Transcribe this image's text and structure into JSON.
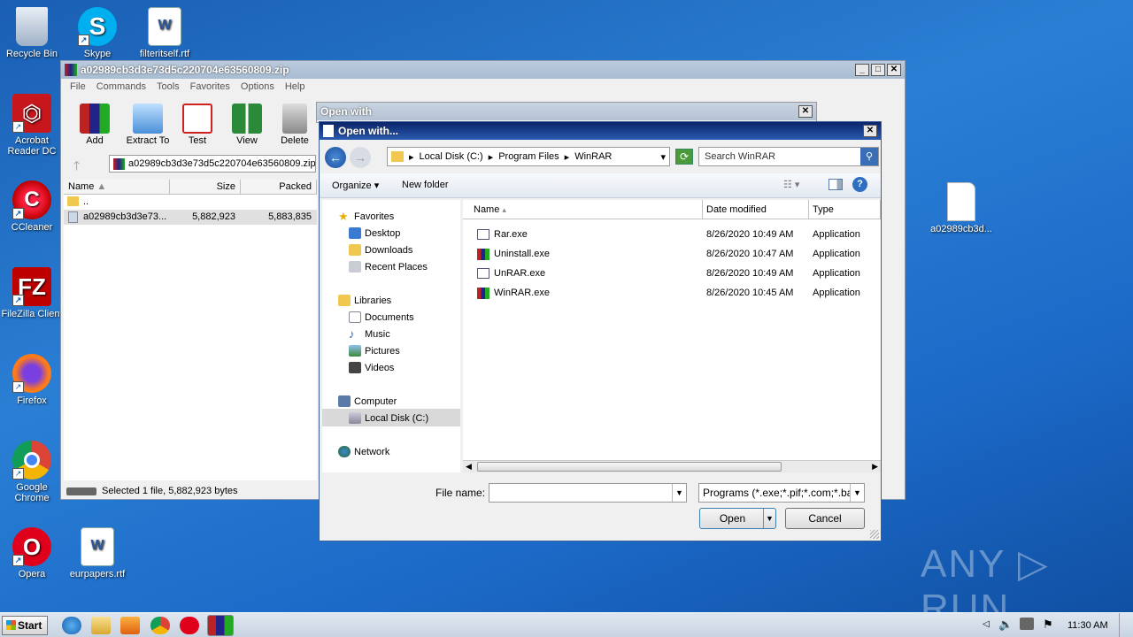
{
  "desktop": {
    "icons": [
      {
        "label": "Recycle Bin"
      },
      {
        "label": "Skype"
      },
      {
        "label": "filteritself.rtf"
      },
      {
        "label": "Acrobat Reader DC"
      },
      {
        "label": "CCleaner"
      },
      {
        "label": "FileZilla Client"
      },
      {
        "label": "Firefox"
      },
      {
        "label": "Google Chrome"
      },
      {
        "label": "Opera"
      },
      {
        "label": "eurpapers.rtf"
      },
      {
        "label": "a02989cb3d..."
      }
    ],
    "watermark": "ANY ▷ RUN"
  },
  "winrar": {
    "title": "a02989cb3d3e73d5c220704e63560809.zip",
    "menu": [
      "File",
      "Commands",
      "Tools",
      "Favorites",
      "Options",
      "Help"
    ],
    "tools": [
      "Add",
      "Extract To",
      "Test",
      "View",
      "Delete"
    ],
    "path": "a02989cb3d3e73d5c220704e63560809.zip",
    "columns": {
      "name": "Name",
      "size": "Size",
      "packed": "Packed"
    },
    "rows": [
      {
        "name": "..",
        "size": "",
        "packed": ""
      },
      {
        "name": "a02989cb3d3e73...",
        "size": "5,882,923",
        "packed": "5,883,835"
      }
    ],
    "status": "Selected 1 file, 5,882,923 bytes"
  },
  "openwith_bg": {
    "title": "Open with"
  },
  "dialog": {
    "title": "Open with...",
    "breadcrumb": [
      "Local Disk (C:)",
      "Program Files",
      "WinRAR"
    ],
    "search_placeholder": "Search WinRAR",
    "organize": "Organize",
    "new_folder": "New folder",
    "nav": {
      "favorites": "Favorites",
      "desktop": "Desktop",
      "downloads": "Downloads",
      "recent": "Recent Places",
      "libraries": "Libraries",
      "documents": "Documents",
      "music": "Music",
      "pictures": "Pictures",
      "videos": "Videos",
      "computer": "Computer",
      "localdisk": "Local Disk (C:)",
      "network": "Network"
    },
    "columns": {
      "name": "Name",
      "date": "Date modified",
      "type": "Type"
    },
    "files": [
      {
        "name": "Rar.exe",
        "date": "8/26/2020 10:49 AM",
        "type": "Application"
      },
      {
        "name": "Uninstall.exe",
        "date": "8/26/2020 10:47 AM",
        "type": "Application"
      },
      {
        "name": "UnRAR.exe",
        "date": "8/26/2020 10:49 AM",
        "type": "Application"
      },
      {
        "name": "WinRAR.exe",
        "date": "8/26/2020 10:45 AM",
        "type": "Application"
      }
    ],
    "filename_label": "File name:",
    "filename_value": "",
    "filter": "Programs (*.exe;*.pif;*.com;*.ba",
    "open": "Open",
    "cancel": "Cancel"
  },
  "taskbar": {
    "start": "Start",
    "clock": "11:30 AM"
  }
}
